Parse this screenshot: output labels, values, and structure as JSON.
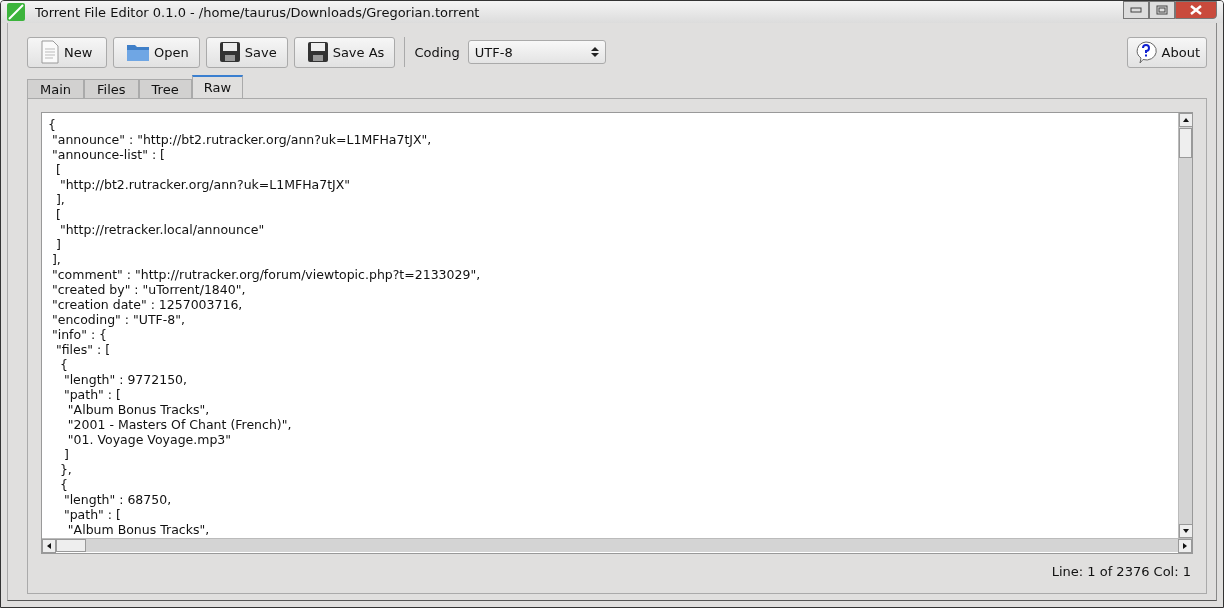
{
  "window": {
    "title": "Torrent File Editor 0.1.0 - /home/taurus/Downloads/Gregorian.torrent"
  },
  "toolbar": {
    "buttons": [
      {
        "label": "New",
        "kind": "new"
      },
      {
        "label": "Open",
        "kind": "open"
      },
      {
        "label": "Save",
        "kind": "save"
      },
      {
        "label": "Save As",
        "kind": "save"
      }
    ],
    "coding_label": "Coding",
    "coding_value": "UTF-8",
    "about": "About"
  },
  "tabs": [
    {
      "label": "Main",
      "selected": false
    },
    {
      "label": "Files",
      "selected": false
    },
    {
      "label": "Tree",
      "selected": false
    },
    {
      "label": "Raw",
      "selected": true
    }
  ],
  "editor": {
    "lines": [
      "{",
      " \"announce\" : \"http://bt2.rutracker.org/ann?uk=L1MFHa7tJX\",",
      " \"announce-list\" : [",
      "  [",
      "   \"http://bt2.rutracker.org/ann?uk=L1MFHa7tJX\"",
      "  ],",
      "  [",
      "   \"http://retracker.local/announce\"",
      "  ]",
      " ],",
      " \"comment\" : \"http://rutracker.org/forum/viewtopic.php?t=2133029\",",
      " \"created by\" : \"uTorrent/1840\",",
      " \"creation date\" : 1257003716,",
      " \"encoding\" : \"UTF-8\",",
      " \"info\" : {",
      "  \"files\" : [",
      "   {",
      "    \"length\" : 9772150,",
      "    \"path\" : [",
      "     \"Album Bonus Tracks\",",
      "     \"2001 - Masters Of Chant (French)\",",
      "     \"01. Voyage Voyage.mp3\"",
      "    ]",
      "   },",
      "   {",
      "    \"length\" : 68750,",
      "    \"path\" : [",
      "     \"Album Bonus Tracks\","
    ]
  },
  "status_bar": "Line: 1 of 2376 Col: 1"
}
